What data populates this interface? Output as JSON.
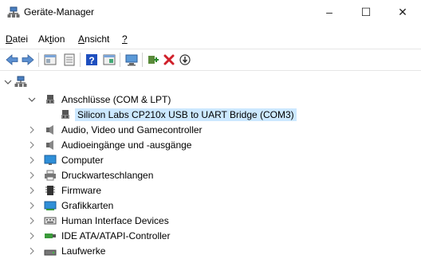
{
  "window": {
    "title": "Geräte-Manager",
    "minimize": "–",
    "maximize": "☐",
    "close": "✕"
  },
  "menu": [
    {
      "label": "Datei",
      "accel": "D"
    },
    {
      "label": "Aktion",
      "accel": "t"
    },
    {
      "label": "Ansicht",
      "accel": "A"
    },
    {
      "label": "?",
      "accel": "?"
    }
  ],
  "toolbar": [
    "back-arrow-icon",
    "forward-arrow-icon",
    "properties-icon",
    "update-driver-icon",
    "help-icon",
    "view-icon",
    "scan-hardware-icon",
    "add-driver-icon",
    "uninstall-icon",
    "disable-icon"
  ],
  "tree": {
    "root_label": "",
    "ports": {
      "label": "Anschlüsse (COM & LPT)",
      "child": "Silicon Labs CP210x USB to UART Bridge (COM3)"
    },
    "categories": [
      "Audio, Video und Gamecontroller",
      "Audioeingänge und -ausgänge",
      "Computer",
      "Druckwarteschlangen",
      "Firmware",
      "Grafikkarten",
      "Human Interface Devices",
      "IDE ATA/ATAPI-Controller",
      "Laufwerke"
    ]
  },
  "colors": {
    "selection": "#cce8ff",
    "close_red": "#d0202a",
    "help_blue": "#1e4fbf"
  }
}
